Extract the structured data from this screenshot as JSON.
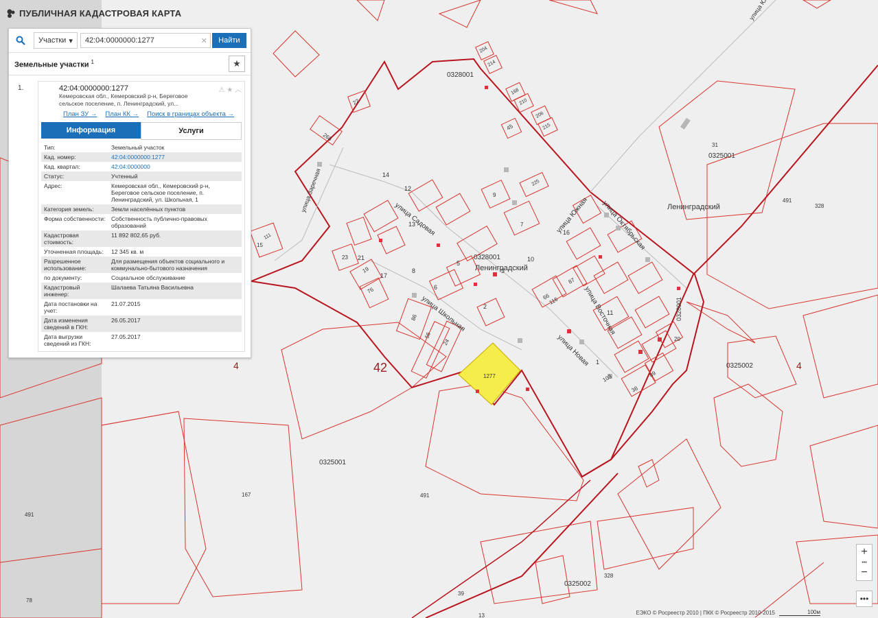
{
  "app": {
    "title": "ПУБЛИЧНАЯ КАДАСТРОВАЯ КАРТА"
  },
  "search": {
    "type_label": "Участки",
    "value": "42:04:0000000:1277",
    "find_label": "Найти"
  },
  "section": {
    "label": "Земельные участки",
    "count": "1"
  },
  "result": {
    "index": "1.",
    "number": "42:04:0000000:1277",
    "address_line1": "Кемеровская обл., Кемеровский р-н, Береговое",
    "address_line2": "сельское поселение, п. Ленинградский, ул...",
    "links": [
      "План ЗУ →",
      "План КК →",
      "Поиск в границах объекта →"
    ]
  },
  "tabs": {
    "info": "Информация",
    "services": "Услуги"
  },
  "info_rows": [
    {
      "k": "Тип:",
      "v": "Земельный участок"
    },
    {
      "k": "Кад. номер:",
      "v": "42:04:0000000:1277"
    },
    {
      "k": "Кад. квартал:",
      "v": "42:04:0000000"
    },
    {
      "k": "Статус:",
      "v": "Учтенный"
    },
    {
      "k": "Адрес:",
      "v": "Кемеровская обл., Кемеровский р-н, Береговое сельское поселение, п. Ленинградский, ул. Школьная, 1"
    },
    {
      "k": "Категория земель:",
      "v": "Земли населённых пунктов"
    },
    {
      "k": "Форма собственности:",
      "v": "Собственность публично-правовых образований"
    },
    {
      "k": "Кадастровая стоимость:",
      "v": "11 892 802,65 руб."
    },
    {
      "k": "Уточненная площадь:",
      "v": "12 345 кв. м"
    },
    {
      "k": "Разрешенное использование:",
      "v": "Для размещения объектов социального и коммунально-бытового назначения"
    },
    {
      "k": "по документу:",
      "v": "Социальное обслуживание"
    },
    {
      "k": "Кадастровый инженер:",
      "v": "Шалаева Татьяна Васильевна"
    },
    {
      "k": "Дата постановки на учет:",
      "v": "21.07.2015"
    },
    {
      "k": "Дата изменения сведений в ГКН:",
      "v": "26.05.2017"
    },
    {
      "k": "Дата выгрузки сведений из ГКН:",
      "v": "27.05.2017"
    }
  ],
  "map": {
    "labels": [
      {
        "t": "0328001"
      },
      {
        "t": "0328001"
      },
      {
        "t": "0328001"
      },
      {
        "t": "0325001"
      },
      {
        "t": "0325001"
      },
      {
        "t": "0325002"
      },
      {
        "t": "0325002"
      },
      {
        "t": "Ленинградский"
      },
      {
        "t": "Ленинградский"
      },
      {
        "t": "42"
      },
      {
        "t": "4"
      },
      {
        "t": "4"
      },
      {
        "t": "491"
      },
      {
        "t": "491"
      },
      {
        "t": "491"
      },
      {
        "t": "328"
      },
      {
        "t": "328"
      },
      {
        "t": "167"
      },
      {
        "t": "31"
      },
      {
        "t": "78"
      },
      {
        "t": "39"
      },
      {
        "t": "13"
      },
      {
        "t": "улица Школьная"
      },
      {
        "t": "улица Садовая"
      },
      {
        "t": "улица Заречная"
      },
      {
        "t": "улица Южная"
      },
      {
        "t": "улица Октябрьская"
      },
      {
        "t": "улица Восточная"
      },
      {
        "t": "улица Новая"
      },
      {
        "t": "улица Южн..."
      },
      {
        "t": "1277"
      },
      {
        "t": "268"
      },
      {
        "t": "22"
      },
      {
        "t": "204"
      },
      {
        "t": "214"
      },
      {
        "t": "168"
      },
      {
        "t": "210"
      },
      {
        "t": "206"
      },
      {
        "t": "215"
      },
      {
        "t": "45"
      },
      {
        "t": "111"
      },
      {
        "t": "15"
      },
      {
        "t": "23"
      },
      {
        "t": "19"
      },
      {
        "t": "76"
      },
      {
        "t": "86"
      },
      {
        "t": "24"
      },
      {
        "t": "56"
      },
      {
        "t": "9"
      },
      {
        "t": "225"
      },
      {
        "t": "7"
      },
      {
        "t": "66"
      },
      {
        "t": "116"
      },
      {
        "t": "87"
      },
      {
        "t": "103"
      },
      {
        "t": "38"
      },
      {
        "t": "89"
      },
      {
        "t": "20"
      },
      {
        "t": "14"
      },
      {
        "t": "12"
      },
      {
        "t": "13"
      },
      {
        "t": "21"
      },
      {
        "t": "17"
      },
      {
        "t": "16"
      },
      {
        "t": "10"
      },
      {
        "t": "11"
      },
      {
        "t": "8"
      },
      {
        "t": "6"
      },
      {
        "t": "5"
      },
      {
        "t": "3"
      },
      {
        "t": "2"
      },
      {
        "t": "1"
      }
    ]
  },
  "attribution": "ЕЭКО © Росреестр 2010 | ПКК © Росреестр 2010-2015",
  "scale_label": "100м",
  "controls": {
    "zoom_in": "+",
    "zoom_out": "−",
    "dots": "•••"
  },
  "colors": {
    "accent": "#1a6fb8",
    "parcel": "#e0303c",
    "highlight": "#f5ee4a",
    "map_bg": "#efefef"
  }
}
